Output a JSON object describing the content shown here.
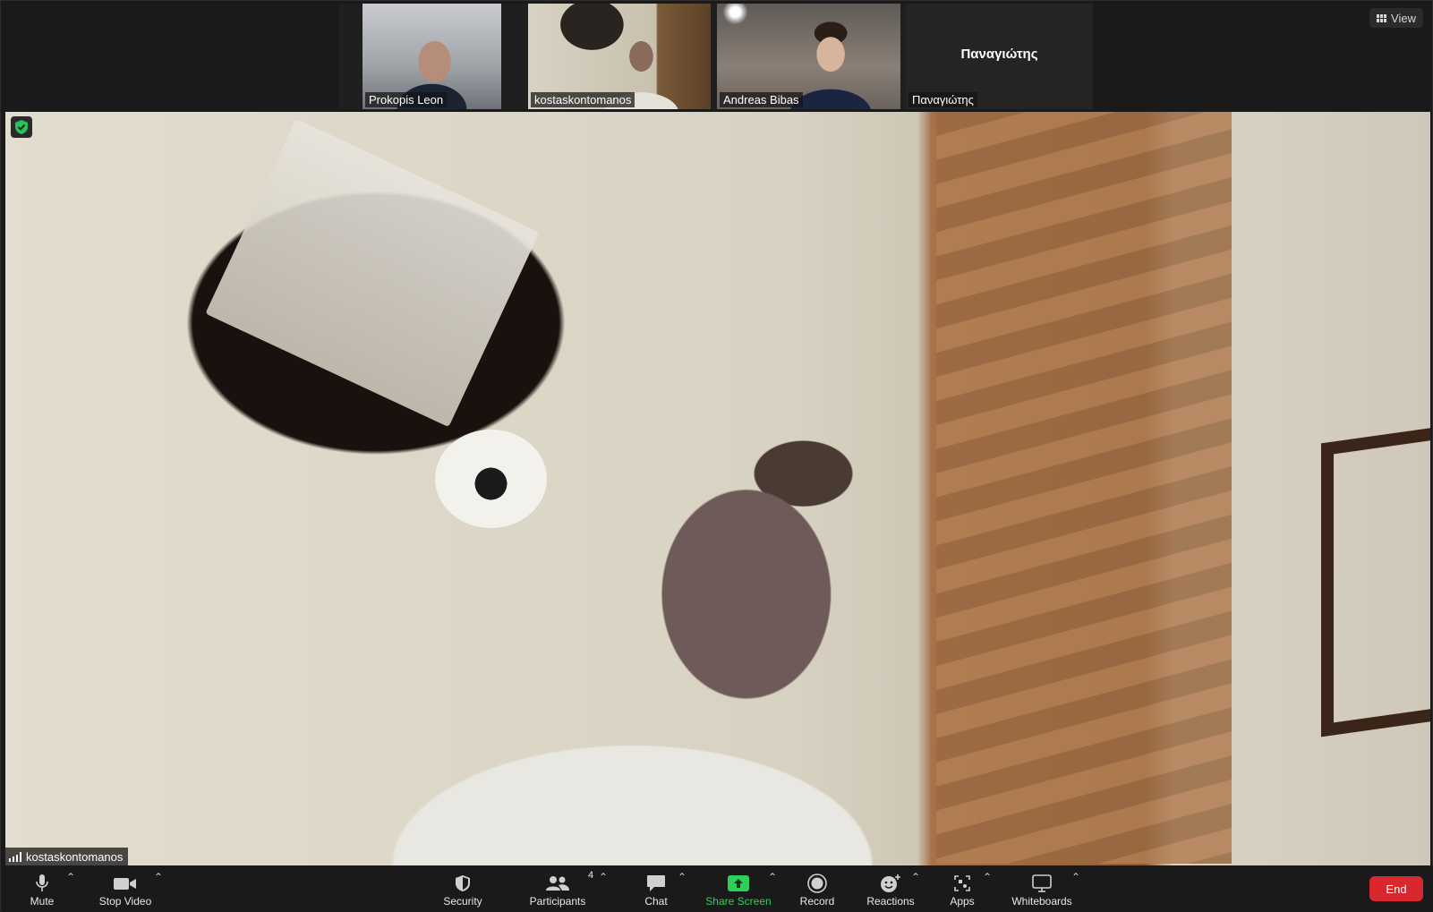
{
  "top_strip": {
    "tiles": [
      {
        "name": "Prokopis Leon"
      },
      {
        "name": "kostaskontomanos"
      },
      {
        "name": "Andreas Bibas"
      },
      {
        "name": "Παναγιώτης",
        "big_name": "Παναγιώτης"
      }
    ]
  },
  "view_button": {
    "label": "View"
  },
  "main_video": {
    "name": "kostaskontomanos"
  },
  "toolbar": {
    "mute": "Mute",
    "stop_video": "Stop Video",
    "security": "Security",
    "participants": "Participants",
    "participants_count": "4",
    "chat": "Chat",
    "share_screen": "Share Screen",
    "record": "Record",
    "reactions": "Reactions",
    "apps": "Apps",
    "whiteboards": "Whiteboards",
    "end": "End"
  },
  "colors": {
    "share_green": "#2fd058",
    "end_red": "#d9272e",
    "active_outline": "#9ccc3c",
    "shield_green": "#26c25a"
  }
}
